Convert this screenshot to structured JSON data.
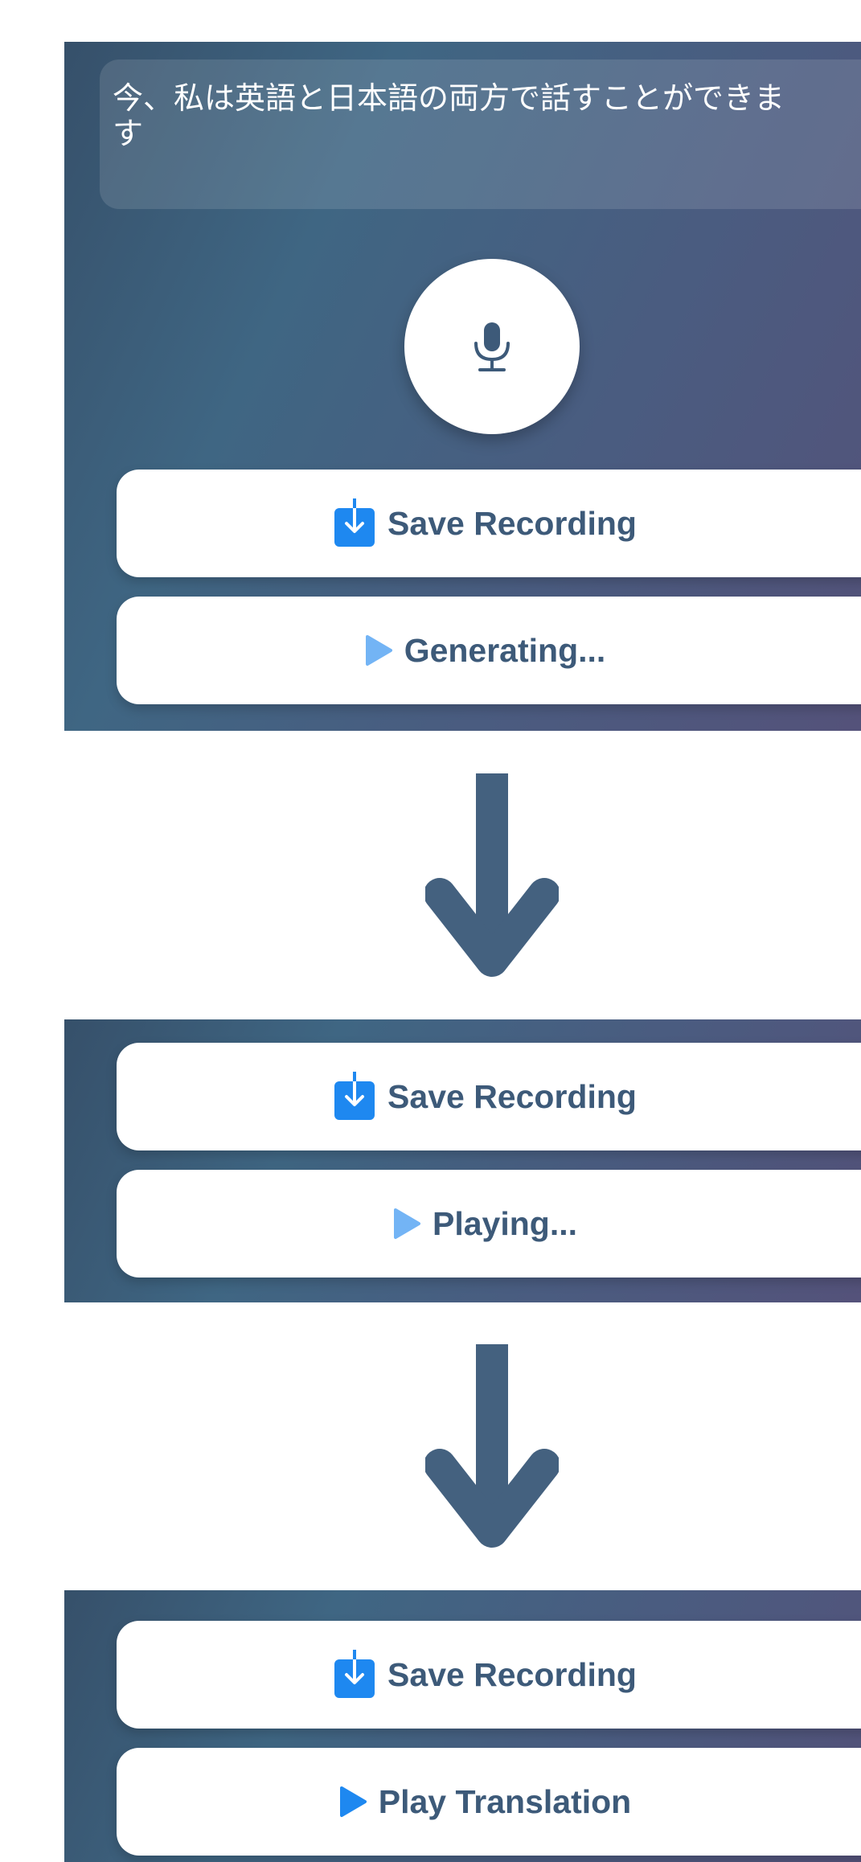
{
  "transcript": {
    "line1": "今、私は英語と日本語の両方で話すことができま",
    "line2": "す"
  },
  "mic": {
    "icon": "microphone-icon"
  },
  "state_generating": {
    "save_label": "Save Recording",
    "play_label": "Generating..."
  },
  "state_playing": {
    "save_label": "Save Recording",
    "play_label": "Playing..."
  },
  "state_ready": {
    "save_label": "Save Recording",
    "play_label": "Play Translation"
  },
  "colors": {
    "accent_blue": "#1e88f0",
    "light_blue": "#73b4f5",
    "button_text": "#3d5a79",
    "arrow": "#44617f"
  }
}
